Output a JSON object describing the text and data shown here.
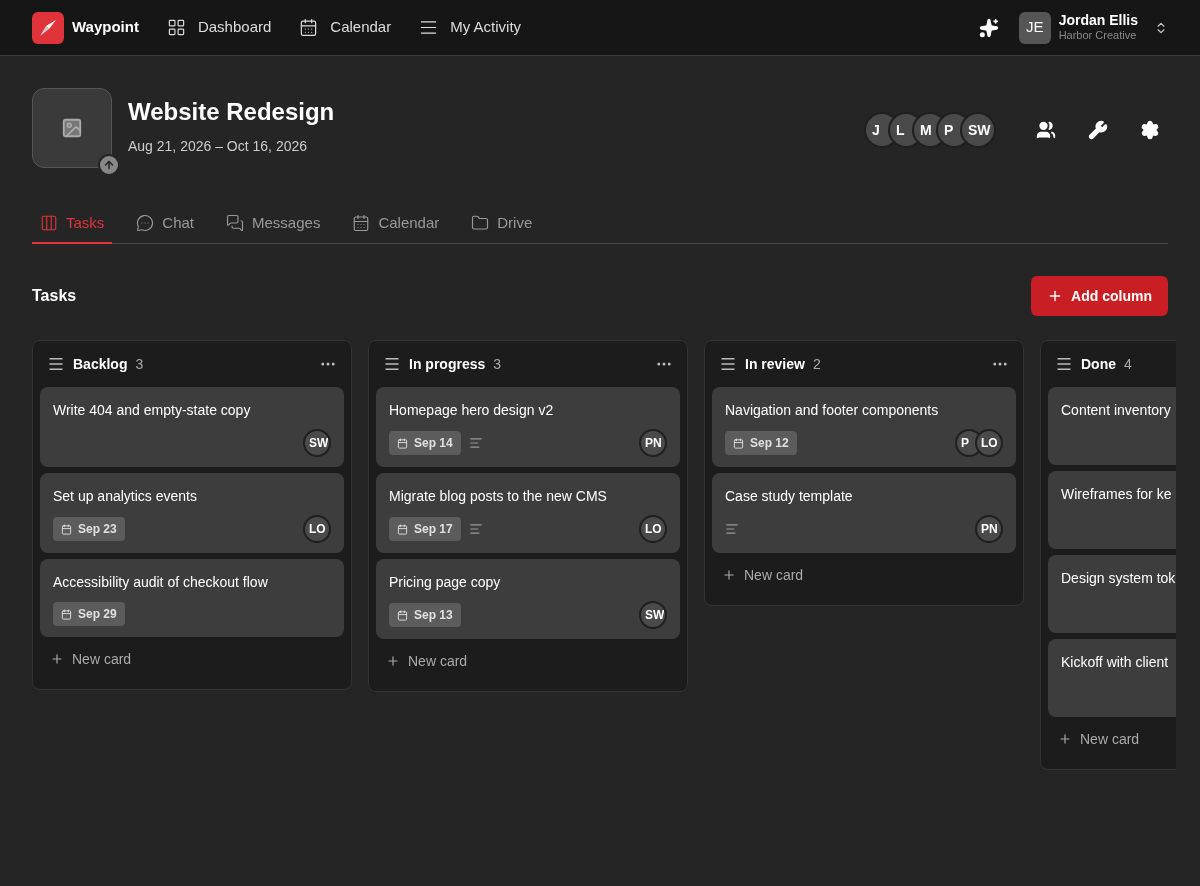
{
  "app": {
    "name": "Waypoint"
  },
  "nav": [
    {
      "label": "Dashboard"
    },
    {
      "label": "Calendar"
    },
    {
      "label": "My Activity"
    }
  ],
  "user": {
    "initials": "JE",
    "name": "Jordan Ellis",
    "org": "Harbor Creative"
  },
  "project": {
    "title": "Website Redesign",
    "dates": "Aug 21, 2026 – Oct 16, 2026",
    "members": [
      "J",
      "L",
      "M",
      "P",
      "SW"
    ]
  },
  "tabs": [
    {
      "label": "Tasks",
      "selected": true
    },
    {
      "label": "Chat",
      "selected": false
    },
    {
      "label": "Messages",
      "selected": false
    },
    {
      "label": "Calendar",
      "selected": false
    },
    {
      "label": "Drive",
      "selected": false
    }
  ],
  "section_title": "Tasks",
  "add_column_button": "Add column",
  "columns": [
    {
      "name": "Backlog",
      "count": "3",
      "menu": true,
      "new_card": "New card",
      "cards": [
        {
          "title": "Write 404 and empty-state copy",
          "assignees": [
            "SW"
          ],
          "has_description": false
        },
        {
          "title": "Set up analytics events",
          "due": "Sep 23",
          "assignees": [
            "LO"
          ],
          "has_description": false
        },
        {
          "title": "Accessibility audit of checkout flow",
          "due": "Sep 29",
          "has_description": false
        }
      ]
    },
    {
      "name": "In progress",
      "count": "3",
      "menu": true,
      "new_card": "New card",
      "cards": [
        {
          "title": "Homepage hero design v2",
          "due": "Sep 14",
          "assignees": [
            "PN"
          ],
          "has_description": true
        },
        {
          "title": "Migrate blog posts to the new CMS",
          "due": "Sep 17",
          "assignees": [
            "LO"
          ],
          "has_description": true
        },
        {
          "title": "Pricing page copy",
          "due": "Sep 13",
          "assignees": [
            "SW"
          ],
          "has_description": false
        }
      ]
    },
    {
      "name": "In review",
      "count": "2",
      "menu": true,
      "new_card": "New card",
      "cards": [
        {
          "title": "Navigation and footer components",
          "due": "Sep 12",
          "assignees": [
            "P",
            "LO"
          ],
          "has_description": false
        },
        {
          "title": "Case study template",
          "assignees": [
            "PN"
          ],
          "has_description": true
        }
      ]
    },
    {
      "name": "Done",
      "count": "4",
      "menu": false,
      "new_card": "New card",
      "cards": [
        {
          "title": "Content inventory",
          "has_description": false
        },
        {
          "title": "Wireframes for ke",
          "has_description": false
        },
        {
          "title": "Design system tok",
          "has_description": false
        },
        {
          "title": "Kickoff with client",
          "has_description": false
        }
      ]
    }
  ]
}
